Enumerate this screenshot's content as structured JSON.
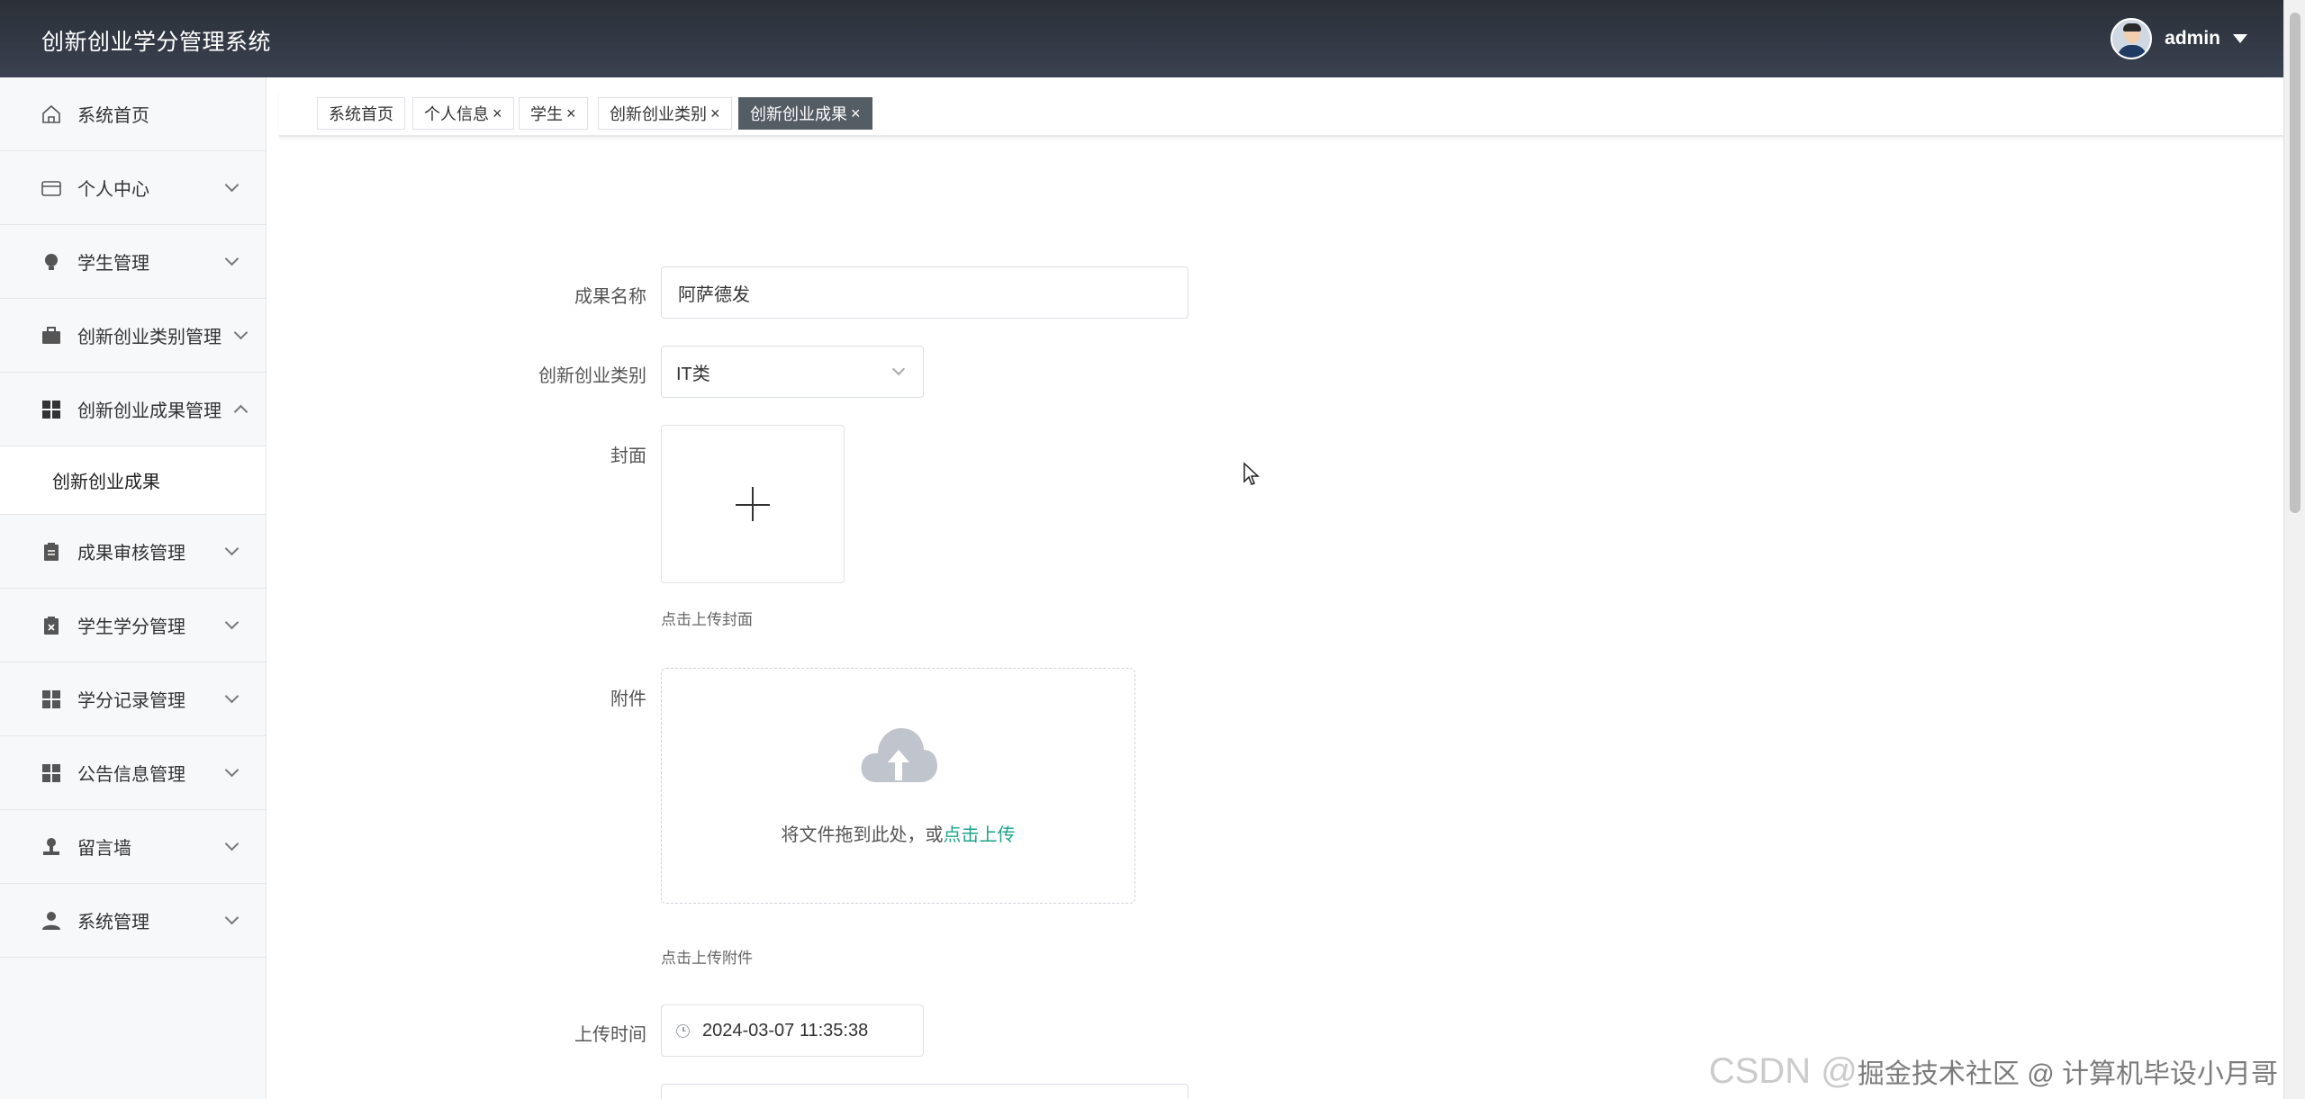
{
  "header": {
    "title": "创新创业学分管理系统",
    "username": "admin"
  },
  "sidebar": {
    "items": [
      {
        "label": "系统首页",
        "icon": "home-icon"
      },
      {
        "label": "个人中心",
        "icon": "card-icon"
      },
      {
        "label": "学生管理",
        "icon": "bulb-icon"
      },
      {
        "label": "创新创业类别管理",
        "icon": "briefcase-icon"
      },
      {
        "label": "创新创业成果管理",
        "icon": "grid-icon"
      },
      {
        "label": "成果审核管理",
        "icon": "clipboard-icon"
      },
      {
        "label": "学生学分管理",
        "icon": "clipboard-x-icon"
      },
      {
        "label": "学分记录管理",
        "icon": "grid-icon"
      },
      {
        "label": "公告信息管理",
        "icon": "grid-icon"
      },
      {
        "label": "留言墙",
        "icon": "stamp-icon"
      },
      {
        "label": "系统管理",
        "icon": "user-icon"
      }
    ],
    "submenu": {
      "label": "创新创业成果"
    }
  },
  "tabs": [
    {
      "label": "系统首页",
      "closable": false
    },
    {
      "label": "个人信息",
      "closable": true
    },
    {
      "label": "学生",
      "closable": true
    },
    {
      "label": "创新创业类别",
      "closable": true
    },
    {
      "label": "创新创业成果",
      "closable": true,
      "active": true
    }
  ],
  "tab_close": "×",
  "form": {
    "name_label": "成果名称",
    "name_value": "阿萨德发",
    "category_label": "创新创业类别",
    "category_value": "IT类",
    "cover_label": "封面",
    "cover_hint": "点击上传封面",
    "attachment_label": "附件",
    "drop_text": "将文件拖到此处，或",
    "drop_link": "点击上传",
    "attachment_hint": "点击上传附件",
    "time_label": "上传时间",
    "time_value": "2024-03-07 11:35:38"
  },
  "watermark": {
    "main": "CSDN @",
    "sub": "掘金技术社区 @ 计算机毕设小月哥"
  },
  "colors": {
    "header": "#2b3038",
    "active_tab": "#545c64",
    "link": "#1aa38a"
  }
}
